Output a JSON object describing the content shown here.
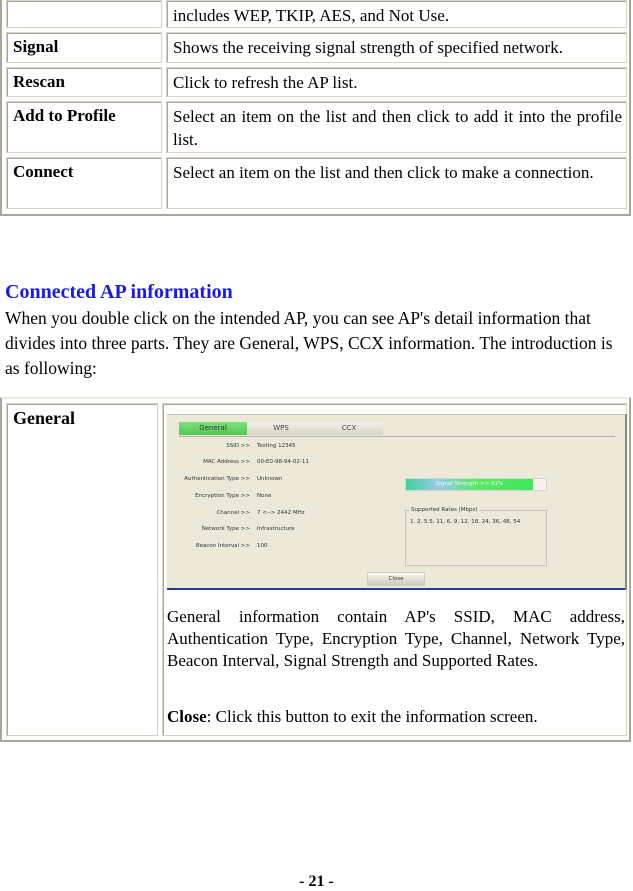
{
  "table1": {
    "rows": [
      {
        "label": "",
        "desc": "includes WEP, TKIP, AES, and Not Use."
      },
      {
        "label": "Signal",
        "desc": "Shows the receiving signal strength of specified network."
      },
      {
        "label": "Rescan",
        "desc": "Click to refresh the AP list."
      },
      {
        "label": "Add to Profile",
        "desc": "Select an item on the list and then click to add it into the profile list."
      },
      {
        "label": "Connect",
        "desc": "Select an item on the list and then click to make a connection."
      }
    ]
  },
  "section": {
    "heading": "Connected AP information",
    "intro": "When you double click on the intended AP, you can see AP's detail information that divides into three parts. They are General, WPS, CCX information. The introduction is as following:"
  },
  "table2": {
    "label": "General",
    "screenshot": {
      "tabs": [
        "General",
        "WPS",
        "CCX"
      ],
      "active_tab": "General",
      "fields": [
        {
          "key": "SSID >>",
          "value": "Testing 12345"
        },
        {
          "key": "MAC Address >>",
          "value": "00-E0-98-94-02-11"
        },
        {
          "key": "Authentication Type >>",
          "value": "Unknown"
        },
        {
          "key": "Encryption Type >>",
          "value": "None"
        },
        {
          "key": "Channel >>",
          "value": "7 <--> 2442 MHz"
        },
        {
          "key": "Network Type >>",
          "value": "Infrastructure"
        },
        {
          "key": "Beacon Interval >>",
          "value": "100"
        }
      ],
      "signal_label": "Signal Strength >> 91%",
      "signal_percent": 91,
      "rates_legend": "Supported Rates (Mbps)",
      "rates_value": "1, 2, 5.5, 11, 6, 9, 12, 18, 24, 36, 48, 54",
      "close_label": "Close"
    },
    "description": "General information contain AP's SSID, MAC address, Authentication Type, Encryption Type, Channel, Network Type, Beacon Interval, Signal Strength and Supported Rates.",
    "close_term": "Close",
    "close_desc": ": Click this button to exit the information screen."
  },
  "page_number": "- 21 -"
}
